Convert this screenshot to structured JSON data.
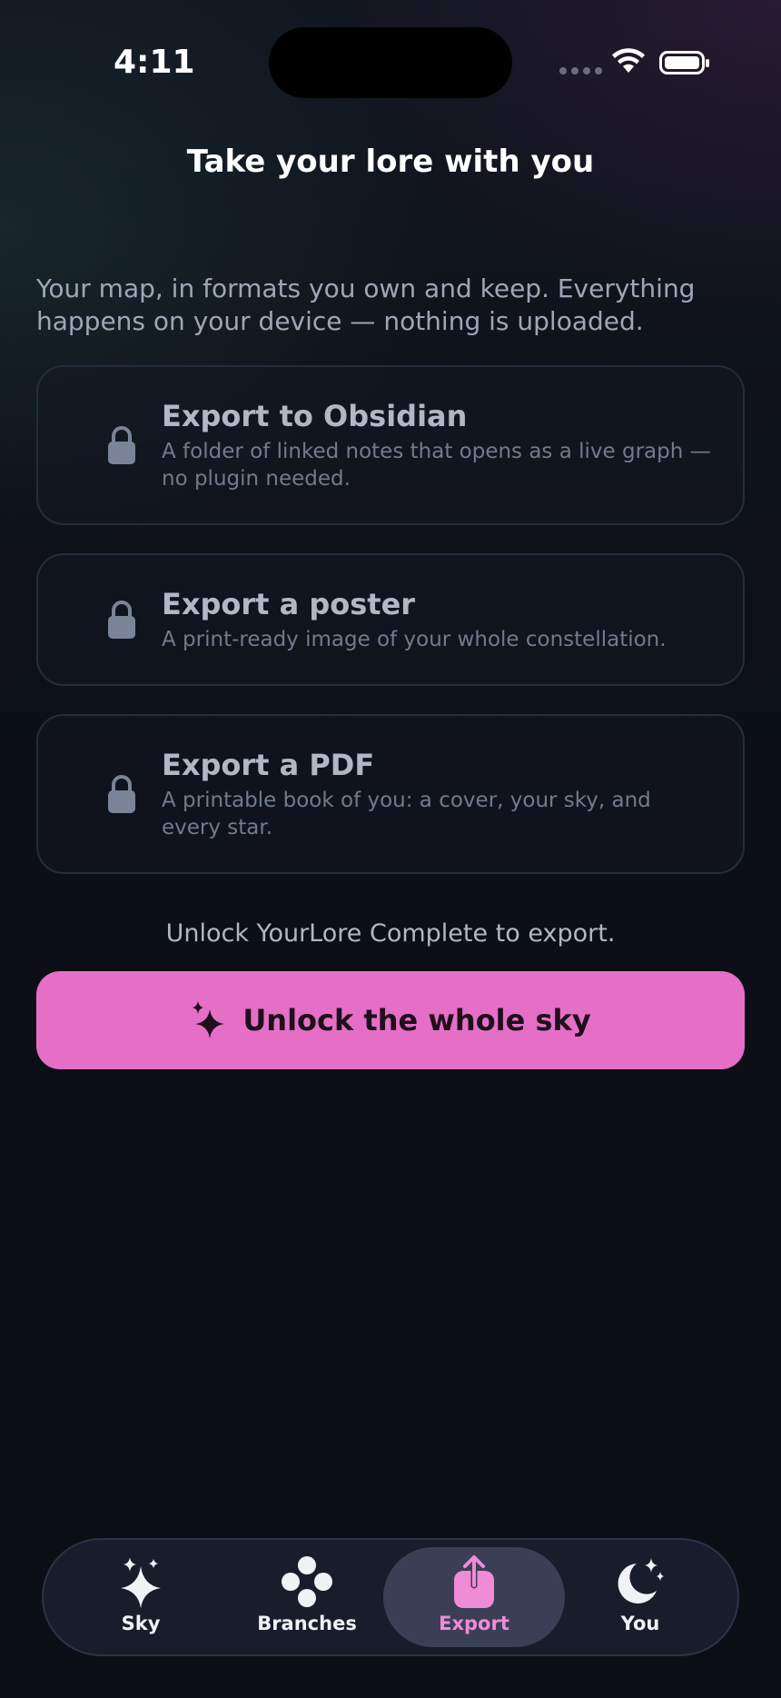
{
  "status_bar": {
    "time": "4:11"
  },
  "header": {
    "title": "Take your lore with you"
  },
  "intro": "Your map, in formats you own and keep. Everything happens on your device — nothing is uploaded.",
  "export_options": [
    {
      "title": "Export to Obsidian",
      "description": "A folder of linked notes that opens as a live graph — no plugin needed.",
      "icon": "lock-icon"
    },
    {
      "title": "Export a poster",
      "description": "A print-ready image of your whole constellation.",
      "icon": "lock-icon"
    },
    {
      "title": "Export a PDF",
      "description": "A printable book of you: a cover, your sky, and every star.",
      "icon": "lock-icon"
    }
  ],
  "unlock": {
    "note": "Unlock YourLore Complete to export.",
    "button_label": "Unlock the whole sky",
    "button_icon": "sparkles-icon"
  },
  "tab_bar": {
    "tabs": [
      {
        "label": "Sky",
        "icon": "sparkles-icon",
        "active": false
      },
      {
        "label": "Branches",
        "icon": "circles-icon",
        "active": false
      },
      {
        "label": "Export",
        "icon": "share-icon",
        "active": true
      },
      {
        "label": "You",
        "icon": "moon-stars-icon",
        "active": false
      }
    ]
  },
  "colors": {
    "accent": "#e56fc6",
    "active_tab_label": "#f08bd6",
    "background": "#0c0f17"
  }
}
